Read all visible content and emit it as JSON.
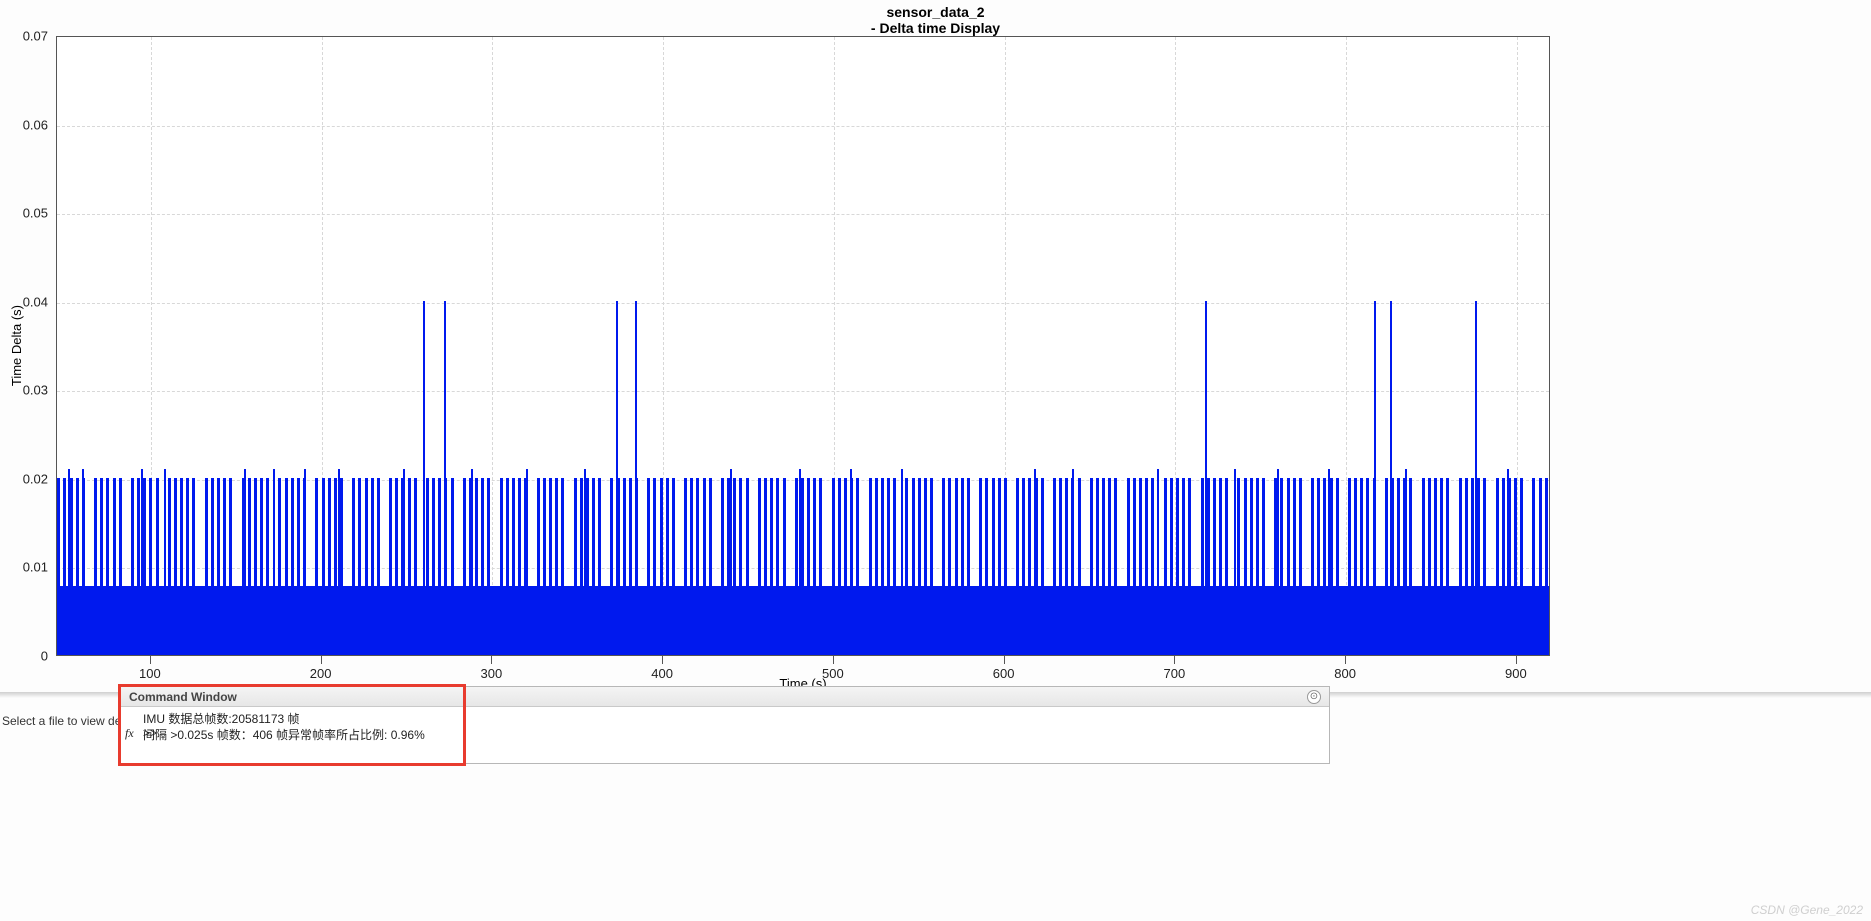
{
  "chart_data": {
    "type": "bar",
    "title": "sensor_data_2\n- Delta time Display",
    "xlabel": "Time (s)",
    "ylabel": "Time Delta (s)",
    "xlim": [
      45,
      920
    ],
    "ylim": [
      0,
      0.07
    ],
    "y_ticks": [
      0,
      0.01,
      0.02,
      0.03,
      0.04,
      0.05,
      0.06,
      0.07
    ],
    "x_ticks": [
      100,
      200,
      300,
      400,
      500,
      600,
      700,
      800,
      900
    ],
    "baseline_value": 0.02,
    "baseline_note": "Dense impulse samples at ~0.02 s with baseline band ~0.008 s; occasional spikes to 0.04 s",
    "spikes_0p04_at_x": [
      260,
      272,
      373,
      384,
      718,
      817,
      826,
      876
    ],
    "spikes_0p021_at_x": [
      52,
      60,
      95,
      108,
      155,
      172,
      190,
      210,
      248,
      288,
      320,
      354,
      440,
      480,
      510,
      540,
      618,
      640,
      690,
      735,
      760,
      790,
      835,
      895
    ],
    "series_generation": {
      "x_start": 46,
      "x_end": 918,
      "step": 3.6,
      "value": 0.02,
      "gap_every": 6
    },
    "low_band": 0.0078
  },
  "titles": {
    "line1": "sensor_data_2",
    "line2": "- Delta time Display"
  },
  "axis": {
    "x": "Time (s)",
    "y": "Time Delta (s)"
  },
  "yTickLabels": [
    "0",
    "0.01",
    "0.02",
    "0.03",
    "0.04",
    "0.05",
    "0.06",
    "0.07"
  ],
  "xTickLabels": [
    "100",
    "200",
    "300",
    "400",
    "500",
    "600",
    "700",
    "800",
    "900"
  ],
  "command_window": {
    "title": "Command Window",
    "line1": "IMU 数据总帧数:20581173 帧",
    "line2": "间隔 >0.025s  帧数：406 帧异常帧率所占比例:  0.96%",
    "prompt": ">>",
    "fx": "fx"
  },
  "sidebar": {
    "select_label": "Select a file to view de"
  },
  "watermark": "CSDN @Gene_2022",
  "icons": {
    "minimize": "⊙"
  }
}
